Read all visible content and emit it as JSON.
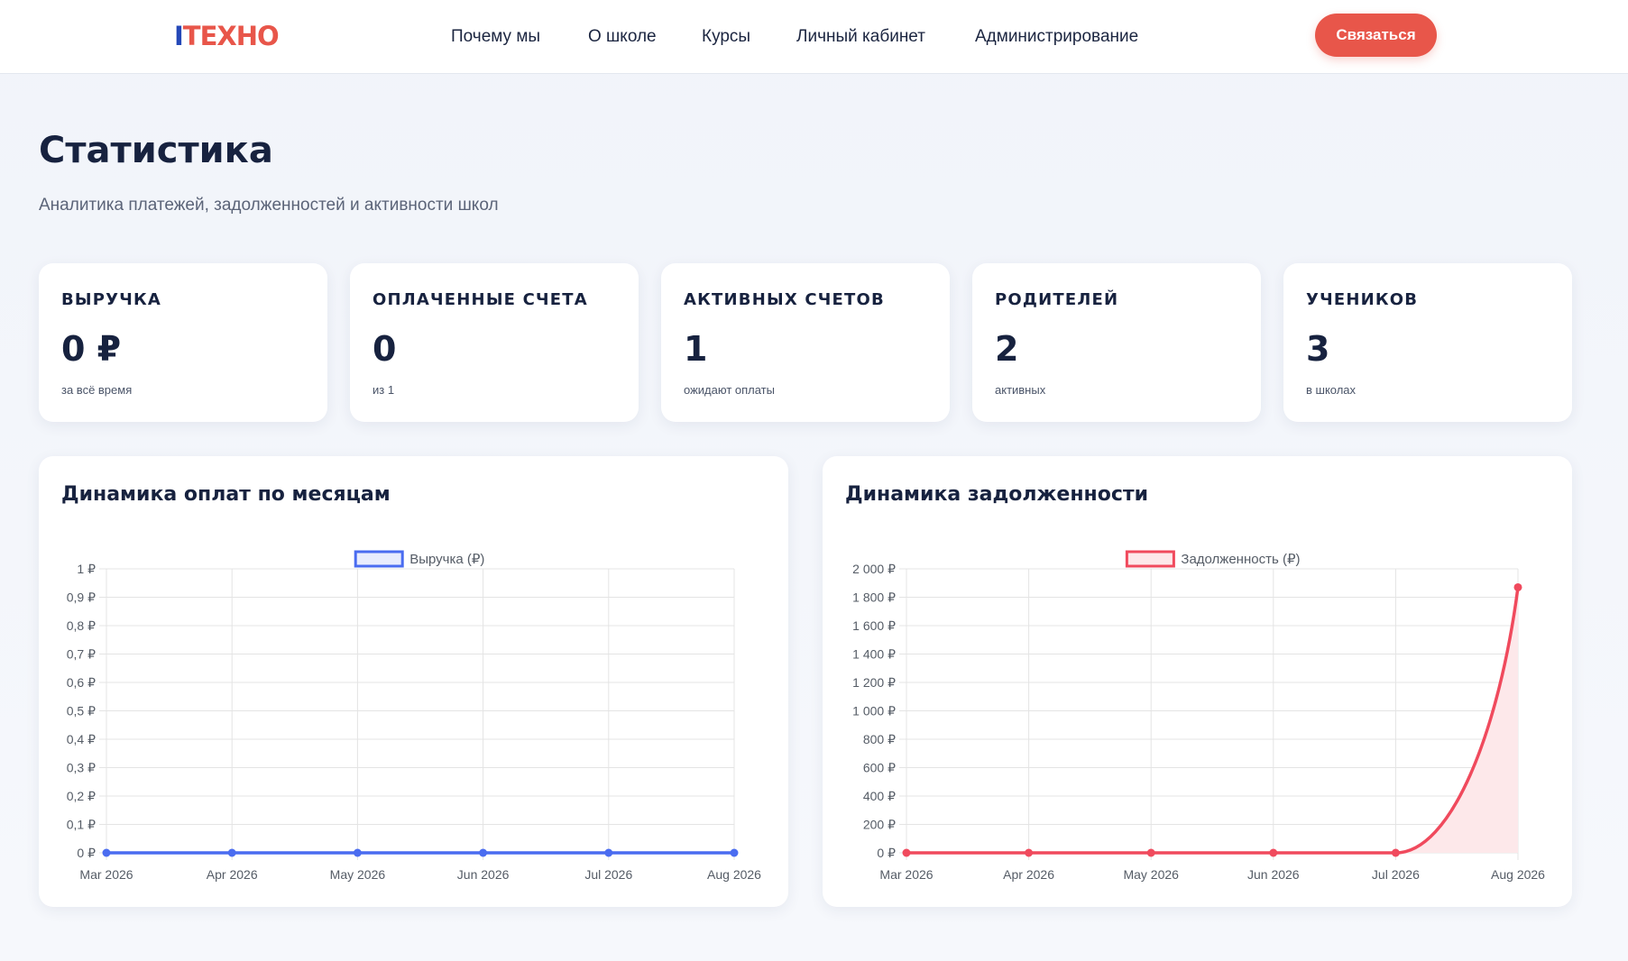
{
  "header": {
    "logo_i": "I",
    "logo_rest": "TEXHO",
    "nav": [
      {
        "label": "Почему мы"
      },
      {
        "label": "О школе"
      },
      {
        "label": "Курсы"
      },
      {
        "label": "Личный кабинет"
      },
      {
        "label": "Администрирование"
      }
    ],
    "cta_label": "Связаться"
  },
  "page": {
    "title": "Статистика",
    "subtitle": "Аналитика платежей, задолженностей и активности школ"
  },
  "cards": [
    {
      "label": "ВЫРУЧКА",
      "value": "0 ₽",
      "hint": "за всё время"
    },
    {
      "label": "ОПЛАЧЕННЫЕ СЧЕТА",
      "value": "0",
      "hint": "из 1"
    },
    {
      "label": "АКТИВНЫХ СЧЕТОВ",
      "value": "1",
      "hint": "ожидают оплаты"
    },
    {
      "label": "РОДИТЕЛЕЙ",
      "value": "2",
      "hint": "активных"
    },
    {
      "label": "УЧЕНИКОВ",
      "value": "3",
      "hint": "в школах"
    }
  ],
  "charts": {
    "payments_title": "Динамика оплат по месяцам",
    "debt_title": "Динамика задолженности"
  },
  "colors": {
    "accent": "#e8564a",
    "brand_blue": "#2448b8",
    "revenue_line": "#4a6cf0",
    "debt_line": "#f04a5d",
    "debt_fill": "#fde8ea"
  },
  "chart_data": [
    {
      "type": "line",
      "title": "",
      "categories": [
        "Mar 2026",
        "Apr 2026",
        "May 2026",
        "Jun 2026",
        "Jul 2026",
        "Aug 2026"
      ],
      "series": [
        {
          "name": "Выручка (₽)",
          "values": [
            0,
            0,
            0,
            0,
            0,
            0
          ]
        }
      ],
      "ylim": [
        0,
        1
      ],
      "yticks": [
        "0 ₽",
        "0,1 ₽",
        "0,2 ₽",
        "0,3 ₽",
        "0,4 ₽",
        "0,5 ₽",
        "0,6 ₽",
        "0,7 ₽",
        "0,8 ₽",
        "0,9 ₽",
        "1 ₽"
      ],
      "grid": true,
      "legend": "top-center"
    },
    {
      "type": "area",
      "title": "",
      "categories": [
        "Mar 2026",
        "Apr 2026",
        "May 2026",
        "Jun 2026",
        "Jul 2026",
        "Aug 2026"
      ],
      "series": [
        {
          "name": "Задолженность (₽)",
          "values": [
            0,
            0,
            0,
            0,
            0,
            1870
          ]
        }
      ],
      "ylim": [
        0,
        2000
      ],
      "yticks": [
        "0 ₽",
        "200 ₽",
        "400 ₽",
        "600 ₽",
        "800 ₽",
        "1 000 ₽",
        "1 200 ₽",
        "1 400 ₽",
        "1 600 ₽",
        "1 800 ₽",
        "2 000 ₽"
      ],
      "grid": true,
      "legend": "top-center"
    }
  ]
}
